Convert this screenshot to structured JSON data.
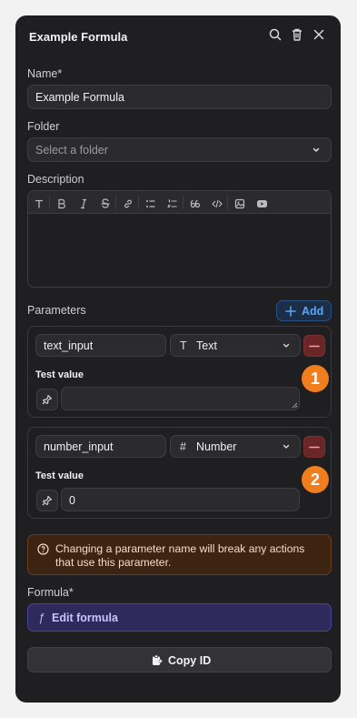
{
  "header": {
    "title": "Example Formula"
  },
  "name_field": {
    "label": "Name",
    "required_mark": "*",
    "value": "Example Formula"
  },
  "folder_field": {
    "label": "Folder",
    "placeholder": "Select a folder"
  },
  "description": {
    "label": "Description",
    "toolbar": [
      "text-icon",
      "bold-icon",
      "italic-icon",
      "strikethrough-icon",
      "link-icon",
      "bullet-list-icon",
      "numbered-list-icon",
      "quote-icon",
      "code-icon",
      "image-icon",
      "video-icon"
    ]
  },
  "parameters": {
    "label": "Parameters",
    "add_label": "Add",
    "items": [
      {
        "name": "text_input",
        "type_glyph": "T",
        "type": "Text",
        "test_label": "Test value",
        "test_value": "",
        "badge": "1"
      },
      {
        "name": "number_input",
        "type_glyph": "#",
        "type": "Number",
        "test_label": "Test value",
        "test_value": "0",
        "badge": "2"
      }
    ]
  },
  "warning": {
    "text_line1": "Changing a parameter name will break any actions",
    "text_line2": "that use this parameter."
  },
  "formula": {
    "label": "Formula",
    "required_mark": "*",
    "glyph": "ƒ",
    "button_label": "Edit formula"
  },
  "copy": {
    "label": "Copy ID"
  },
  "colors": {
    "panel": "#1f1f21",
    "accent_blue": "#5aa6ff",
    "badge_orange": "#f07d1e",
    "danger": "#6a2626",
    "formula_bg": "#2e2a5c",
    "warning_bg": "#3d2412"
  }
}
